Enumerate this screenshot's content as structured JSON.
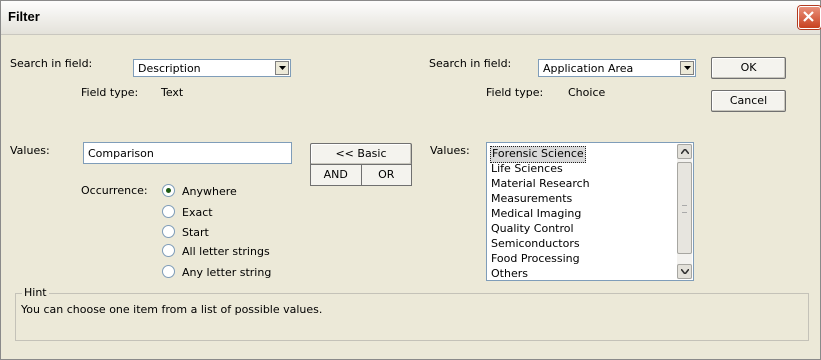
{
  "window": {
    "title": "Filter"
  },
  "left": {
    "search_label": "Search in field:",
    "search_value": "Description",
    "fieldtype_label": "Field type:",
    "fieldtype_value": "Text",
    "values_label": "Values:",
    "values_input": "Comparison",
    "occurrence_label": "Occurrence:",
    "occurrence_options": [
      {
        "label": "Anywhere",
        "checked": true
      },
      {
        "label": "Exact",
        "checked": false
      },
      {
        "label": "Start",
        "checked": false
      },
      {
        "label": "All letter strings",
        "checked": false
      },
      {
        "label": "Any letter string",
        "checked": false
      }
    ]
  },
  "middle": {
    "basic_label": "<< Basic",
    "and_label": "AND",
    "or_label": "OR"
  },
  "right": {
    "search_label": "Search in field:",
    "search_value": "Application Area",
    "fieldtype_label": "Field type:",
    "fieldtype_value": "Choice",
    "values_label": "Values:",
    "list_items": [
      "Forensic Science",
      "Life Sciences",
      "Material Research",
      "Measurements",
      "Medical Imaging",
      "Quality Control",
      "Semiconductors",
      "Food Processing",
      "Others"
    ],
    "selected_item": "Forensic Science"
  },
  "buttons": {
    "ok_label": "OK",
    "cancel_label": "Cancel"
  },
  "hint": {
    "legend": "Hint",
    "text": "You can choose one item from a list of possible values."
  }
}
